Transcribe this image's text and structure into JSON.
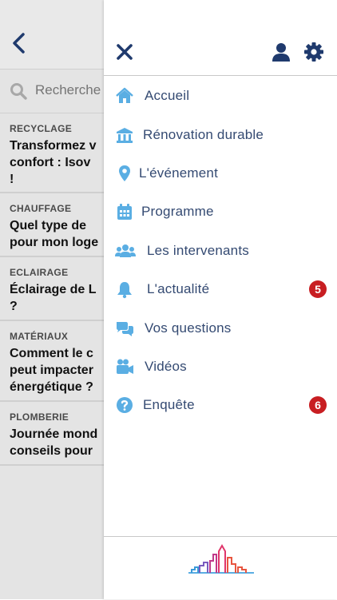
{
  "background": {
    "search": {
      "placeholder": "Recherche"
    },
    "articles": [
      {
        "category": "RECYCLAGE",
        "title_lines": [
          "Transformez v",
          "confort : Isov",
          "!"
        ]
      },
      {
        "category": "CHAUFFAGE",
        "title_lines": [
          "Quel type de",
          "pour mon loge"
        ]
      },
      {
        "category": "ECLAIRAGE",
        "title_lines": [
          "Éclairage de L",
          "?"
        ]
      },
      {
        "category": "MATÉRIAUX",
        "title_lines": [
          "Comment le c",
          "peut impacter",
          "énergétique ?"
        ]
      },
      {
        "category": "PLOMBERIE",
        "title_lines": [
          "Journée mond",
          "conseils pour"
        ]
      }
    ]
  },
  "drawer": {
    "menu": [
      {
        "label": "Accueil",
        "icon": "home-icon",
        "badge": null
      },
      {
        "label": "Rénovation durable",
        "icon": "building-icon",
        "badge": null
      },
      {
        "label": "L'événement",
        "icon": "location-pin-icon",
        "badge": null
      },
      {
        "label": "Programme",
        "icon": "calendar-icon",
        "badge": null
      },
      {
        "label": "Les intervenants",
        "icon": "people-icon",
        "badge": null
      },
      {
        "label": "L'actualité",
        "icon": "bell-icon",
        "badge": "5"
      },
      {
        "label": "Vos questions",
        "icon": "chat-bubbles-icon",
        "badge": null
      },
      {
        "label": "Vidéos",
        "icon": "video-camera-icon",
        "badge": null
      },
      {
        "label": "Enquête",
        "icon": "question-circle-icon",
        "badge": "6"
      }
    ]
  },
  "colors": {
    "accent_dark": "#1f3a6d",
    "menu_text": "#344a72",
    "icon_light_blue": "#5aaee3",
    "badge_red": "#c81e22"
  }
}
